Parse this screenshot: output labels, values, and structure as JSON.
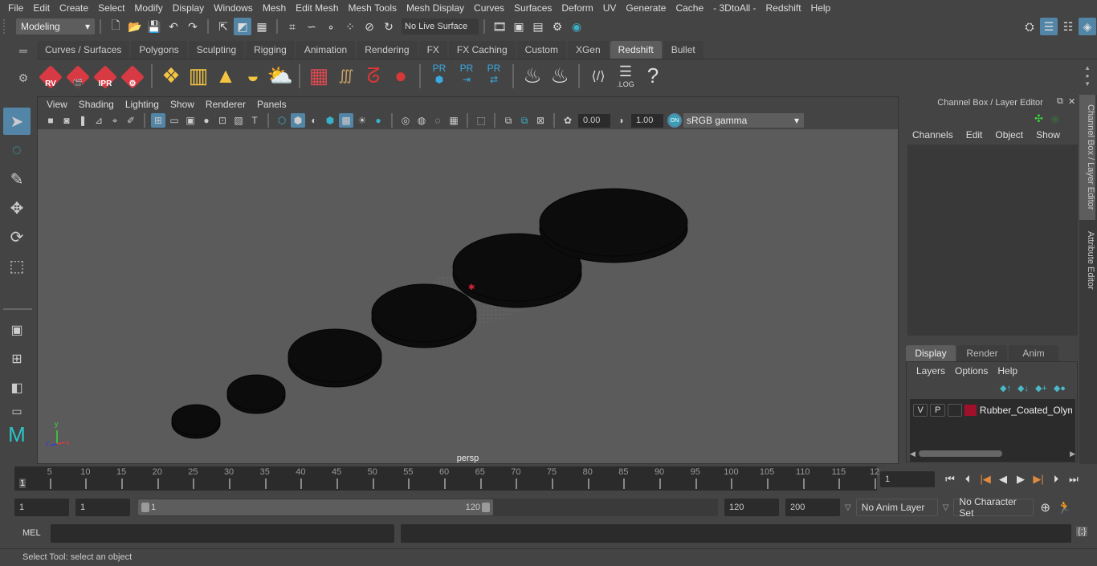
{
  "menubar": [
    "File",
    "Edit",
    "Create",
    "Select",
    "Modify",
    "Display",
    "Windows",
    "Mesh",
    "Edit Mesh",
    "Mesh Tools",
    "Mesh Display",
    "Curves",
    "Surfaces",
    "Deform",
    "UV",
    "Generate",
    "Cache",
    "- 3DtoAll -",
    "Redshift",
    "Help"
  ],
  "statusline": {
    "workspace": "Modeling",
    "live_surface": "No Live Surface"
  },
  "shelf": {
    "tabs": [
      "Curves / Surfaces",
      "Polygons",
      "Sculpting",
      "Rigging",
      "Animation",
      "Rendering",
      "FX",
      "FX Caching",
      "Custom",
      "XGen",
      "Redshift",
      "Bullet"
    ],
    "active_tab": "Redshift",
    "rs_labels": [
      "RV",
      "",
      "IPR",
      ""
    ],
    "pr_label": "PR",
    "log_label": ".LOG",
    "help_glyph": "?"
  },
  "viewport": {
    "menu": [
      "View",
      "Shading",
      "Lighting",
      "Show",
      "Renderer",
      "Panels"
    ],
    "exposure": "0.00",
    "gamma": "1.00",
    "on_badge": "ON",
    "color_space": "sRGB gamma",
    "camera": "persp",
    "axis": {
      "x": "x",
      "y": "y",
      "z": "z"
    }
  },
  "right_panel": {
    "title": "Channel Box / Layer Editor",
    "channel_menu": [
      "Channels",
      "Edit",
      "Object",
      "Show"
    ],
    "layer_tabs": [
      "Display",
      "Render",
      "Anim"
    ],
    "active_layer_tab": "Display",
    "layer_menu": [
      "Layers",
      "Options",
      "Help"
    ],
    "layers": [
      {
        "v": "V",
        "p": "P",
        "color": "#a0102a",
        "name": "Rubber_Coated_Olymp"
      }
    ]
  },
  "side_tabs": [
    "Channel Box / Layer Editor",
    "Attribute Editor"
  ],
  "timeline": {
    "ticks": [
      5,
      10,
      15,
      20,
      25,
      30,
      35,
      40,
      45,
      50,
      55,
      60,
      65,
      70,
      75,
      80,
      85,
      90,
      95,
      100,
      105,
      110,
      115,
      "12"
    ],
    "start_marker": "1",
    "current_frame": "1"
  },
  "range": {
    "start": "1",
    "anim_start": "1",
    "slider_start": "1",
    "slider_end": "120",
    "end": "120",
    "anim_end": "200",
    "anim_layer": "No Anim Layer",
    "character_set": "No Character Set"
  },
  "mel": {
    "label": "MEL"
  },
  "status": {
    "help": "Select Tool: select an object"
  }
}
